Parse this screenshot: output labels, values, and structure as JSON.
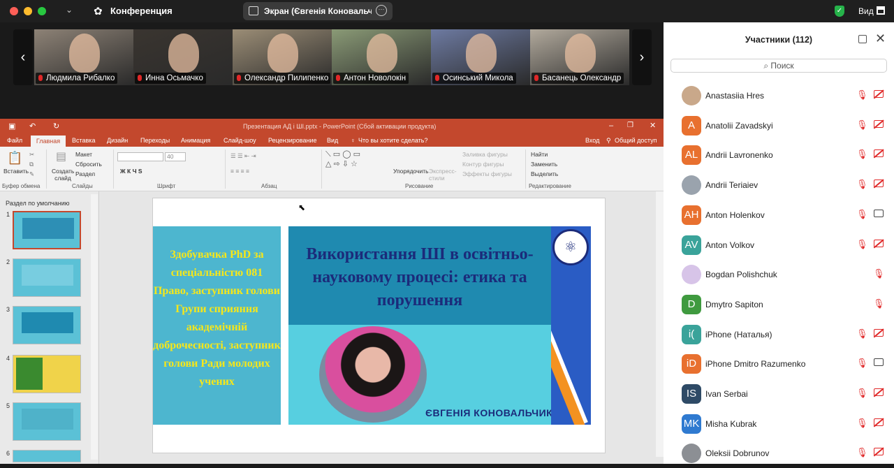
{
  "app": {
    "window_title": "Конференция",
    "share_label": "Экран (Євгенія Коновальчик)",
    "view_label": "Вид"
  },
  "videos": [
    {
      "name": "Людмила Рибалко",
      "bg": "#8d8276"
    },
    {
      "name": "Инна Осьмачко",
      "bg": "#3a3530"
    },
    {
      "name": "Олександр Пилипенко",
      "bg": "#9b8d76"
    },
    {
      "name": "Антон Новолокін",
      "bg": "#8a9a76"
    },
    {
      "name": "Осинський Микола",
      "bg": "#6d7aa1"
    },
    {
      "name": "Басанець Олександр",
      "bg": "#b1a99c"
    }
  ],
  "ppt": {
    "title": "Презентация АД і ШІ.pptx - PowerPoint (Сбой активации продукта)",
    "tabs": [
      "Файл",
      "Главная",
      "Вставка",
      "Дизайн",
      "Переходы",
      "Анимация",
      "Слайд-шоу",
      "Рецензирование",
      "Вид"
    ],
    "tell_me": "Что вы хотите сделать?",
    "login": "Вход",
    "share": "Общий доступ",
    "ribbon": {
      "paste": "Вставить",
      "clipboard": "Буфер обмена",
      "new_slide": "Создать слайд",
      "layout": "Макет",
      "reset": "Сбросить",
      "section": "Раздел",
      "slides": "Слайды",
      "font_box": "",
      "size_box": "40",
      "font": "Шрифт",
      "paragraph": "Абзац",
      "arrange": "Упорядочить",
      "express": "Экспресс-стили",
      "fill": "Заливка фигуры",
      "outline": "Контур фигуры",
      "effects": "Эффекты фигуры",
      "drawing": "Рисование",
      "find": "Найти",
      "replace": "Заменить",
      "select": "Выделить",
      "editing": "Редактирование"
    },
    "section_label": "Раздел по умолчанию",
    "slide_numbers": [
      "1",
      "2",
      "3",
      "4",
      "5",
      "6"
    ],
    "slide": {
      "left_text": "Здобувачка PhD за спеціальністю 081 Право, заступник голови Групи сприяння академічній доброчесності, заступник голови Ради молодих учених",
      "title": "Використання ШІ в освітньо-науковому процесі: етика та порушення",
      "name": "ЄВГЕНІЯ КОНОВАЛЬЧИК,"
    }
  },
  "participants": {
    "title": "Участники (112)",
    "search_placeholder": "Поиск",
    "list": [
      {
        "initials": "",
        "name": "Anastasiia Hres",
        "color": "#c9a88a",
        "video": "off"
      },
      {
        "initials": "A",
        "name": "Anatolii Zavadskyi",
        "color": "#e8702f",
        "video": "off"
      },
      {
        "initials": "AL",
        "name": "Andrii Lavronenko",
        "color": "#e8702f",
        "video": "off"
      },
      {
        "initials": "",
        "name": "Andrii Teriaiev",
        "color": "#9aa3ad",
        "video": "off"
      },
      {
        "initials": "AH",
        "name": "Anton Holenkov",
        "color": "#e8702f",
        "video": "on"
      },
      {
        "initials": "AV",
        "name": "Anton Volkov",
        "color": "#3aa39a",
        "video": "off"
      },
      {
        "initials": "",
        "name": "Bogdan Polishchuk",
        "color": "#d7c4e8",
        "video": "none"
      },
      {
        "initials": "D",
        "name": "Dmytro Sapiton",
        "color": "#3f9a3f",
        "video": "none"
      },
      {
        "initials": "i(",
        "name": "iPhone (Наталья)",
        "color": "#3aa39a",
        "video": "off"
      },
      {
        "initials": "iD",
        "name": "iPhone Dmitro Razumenko",
        "color": "#e8702f",
        "video": "on"
      },
      {
        "initials": "IS",
        "name": "Ivan Serbai",
        "color": "#2e4a66",
        "video": "off"
      },
      {
        "initials": "MK",
        "name": "Misha Kubrak",
        "color": "#2f7ad0",
        "video": "off"
      },
      {
        "initials": "",
        "name": "Oleksii Dobrunov",
        "color": "#8c8f94",
        "video": "off"
      }
    ]
  }
}
